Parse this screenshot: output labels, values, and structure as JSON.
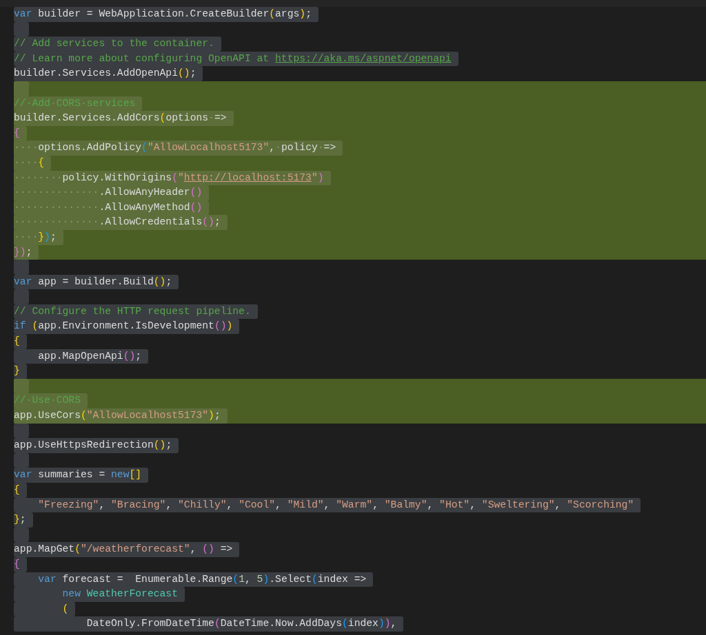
{
  "editor": {
    "lines": [
      {
        "selected": true,
        "added": false,
        "tokens": [
          {
            "kind": "kw",
            "text": "var"
          },
          {
            "kind": "id",
            "text": " builder = WebApplication.CreateBuilder"
          },
          {
            "kind": "b1",
            "text": "("
          },
          {
            "kind": "id",
            "text": "args"
          },
          {
            "kind": "b1",
            "text": ")"
          },
          {
            "kind": "id",
            "text": ";"
          }
        ]
      },
      {
        "selected": true,
        "added": false
      },
      {
        "selected": true,
        "added": false,
        "tokens": [
          {
            "kind": "cm",
            "text": "// Add services to the container."
          }
        ]
      },
      {
        "selected": true,
        "added": false,
        "tokens": [
          {
            "kind": "cm",
            "text": "// Learn more about configuring OpenAPI at "
          },
          {
            "kind": "link",
            "text": "https://aka.ms/aspnet/openapi"
          }
        ]
      },
      {
        "selected": true,
        "added": false,
        "tokens": [
          {
            "kind": "id",
            "text": "builder.Services.AddOpenApi"
          },
          {
            "kind": "b1",
            "text": "()"
          },
          {
            "kind": "id",
            "text": ";"
          }
        ]
      },
      {
        "selected": true,
        "added": true
      },
      {
        "selected": true,
        "added": true,
        "tokens": [
          {
            "kind": "cm",
            "text": "//·Add·CORS·services"
          }
        ]
      },
      {
        "selected": true,
        "added": true,
        "tokens": [
          {
            "kind": "id",
            "text": "builder.Services.AddCors"
          },
          {
            "kind": "b1",
            "text": "("
          },
          {
            "kind": "id",
            "text": "options"
          },
          {
            "kind": "ws",
            "text": "·"
          },
          {
            "kind": "id",
            "text": "=>"
          }
        ]
      },
      {
        "selected": true,
        "added": true,
        "tokens": [
          {
            "kind": "b2",
            "text": "{"
          }
        ]
      },
      {
        "selected": true,
        "added": true,
        "tokens": [
          {
            "kind": "ws",
            "text": "····"
          },
          {
            "kind": "id",
            "text": "options.AddPolicy"
          },
          {
            "kind": "b3",
            "text": "("
          },
          {
            "kind": "str",
            "text": "\"AllowLocalhost5173\""
          },
          {
            "kind": "id",
            "text": ","
          },
          {
            "kind": "ws",
            "text": "·"
          },
          {
            "kind": "id",
            "text": "policy"
          },
          {
            "kind": "ws",
            "text": "·"
          },
          {
            "kind": "id",
            "text": "=>"
          }
        ]
      },
      {
        "selected": true,
        "added": true,
        "tokens": [
          {
            "kind": "ws",
            "text": "····"
          },
          {
            "kind": "b1",
            "text": "{"
          }
        ]
      },
      {
        "selected": true,
        "added": true,
        "tokens": [
          {
            "kind": "ws",
            "text": "········"
          },
          {
            "kind": "id",
            "text": "policy.WithOrigins"
          },
          {
            "kind": "b2",
            "text": "("
          },
          {
            "kind": "str",
            "text": "\""
          },
          {
            "kind": "strlink",
            "text": "http://localhost:5173"
          },
          {
            "kind": "str",
            "text": "\""
          },
          {
            "kind": "b2",
            "text": ")"
          }
        ]
      },
      {
        "selected": true,
        "added": true,
        "tokens": [
          {
            "kind": "ws",
            "text": "··············"
          },
          {
            "kind": "id",
            "text": ".AllowAnyHeader"
          },
          {
            "kind": "b2",
            "text": "()"
          }
        ]
      },
      {
        "selected": true,
        "added": true,
        "tokens": [
          {
            "kind": "ws",
            "text": "··············"
          },
          {
            "kind": "id",
            "text": ".AllowAnyMethod"
          },
          {
            "kind": "b2",
            "text": "()"
          }
        ]
      },
      {
        "selected": true,
        "added": true,
        "tokens": [
          {
            "kind": "ws",
            "text": "··············"
          },
          {
            "kind": "id",
            "text": ".AllowCredentials"
          },
          {
            "kind": "b2",
            "text": "()"
          },
          {
            "kind": "id",
            "text": ";"
          }
        ]
      },
      {
        "selected": true,
        "added": true,
        "tokens": [
          {
            "kind": "ws",
            "text": "····"
          },
          {
            "kind": "b1",
            "text": "}"
          },
          {
            "kind": "b3",
            "text": ")"
          },
          {
            "kind": "id",
            "text": ";"
          }
        ]
      },
      {
        "selected": true,
        "added": true,
        "tokens": [
          {
            "kind": "b2",
            "text": "})"
          },
          {
            "kind": "id",
            "text": ";"
          }
        ]
      },
      {
        "selected": true,
        "added": false
      },
      {
        "selected": true,
        "added": false,
        "tokens": [
          {
            "kind": "kw",
            "text": "var"
          },
          {
            "kind": "id",
            "text": " app = builder.Build"
          },
          {
            "kind": "b1",
            "text": "()"
          },
          {
            "kind": "id",
            "text": ";"
          }
        ]
      },
      {
        "selected": true,
        "added": false
      },
      {
        "selected": true,
        "added": false,
        "tokens": [
          {
            "kind": "cm",
            "text": "// Configure the HTTP request pipeline."
          }
        ]
      },
      {
        "selected": true,
        "added": false,
        "tokens": [
          {
            "kind": "kw",
            "text": "if"
          },
          {
            "kind": "b1",
            "text": " ("
          },
          {
            "kind": "id",
            "text": "app.Environment.IsDevelopment"
          },
          {
            "kind": "b2",
            "text": "()"
          },
          {
            "kind": "b1",
            "text": ")"
          }
        ]
      },
      {
        "selected": true,
        "added": false,
        "tokens": [
          {
            "kind": "b1",
            "text": "{"
          }
        ]
      },
      {
        "selected": true,
        "added": false,
        "tokens": [
          {
            "kind": "id",
            "text": "    app.MapOpenApi"
          },
          {
            "kind": "b2",
            "text": "()"
          },
          {
            "kind": "id",
            "text": ";"
          }
        ]
      },
      {
        "selected": true,
        "added": false,
        "tokens": [
          {
            "kind": "b1",
            "text": "}"
          }
        ]
      },
      {
        "selected": true,
        "added": true
      },
      {
        "selected": true,
        "added": true,
        "tokens": [
          {
            "kind": "cm",
            "text": "//·Use·CORS"
          }
        ]
      },
      {
        "selected": true,
        "added": true,
        "tokens": [
          {
            "kind": "id",
            "text": "app.UseCors"
          },
          {
            "kind": "b1",
            "text": "("
          },
          {
            "kind": "str",
            "text": "\"AllowLocalhost5173\""
          },
          {
            "kind": "b1",
            "text": ")"
          },
          {
            "kind": "id",
            "text": ";"
          }
        ]
      },
      {
        "selected": true,
        "added": false
      },
      {
        "selected": true,
        "added": false,
        "tokens": [
          {
            "kind": "id",
            "text": "app.UseHttpsRedirection"
          },
          {
            "kind": "b1",
            "text": "()"
          },
          {
            "kind": "id",
            "text": ";"
          }
        ]
      },
      {
        "selected": true,
        "added": false
      },
      {
        "selected": true,
        "added": false,
        "tokens": [
          {
            "kind": "kw",
            "text": "var"
          },
          {
            "kind": "id",
            "text": " summaries = "
          },
          {
            "kind": "kw",
            "text": "new"
          },
          {
            "kind": "b1",
            "text": "[]"
          }
        ]
      },
      {
        "selected": true,
        "added": false,
        "tokens": [
          {
            "kind": "b1",
            "text": "{"
          }
        ]
      },
      {
        "selected": true,
        "added": false,
        "tokens": [
          {
            "kind": "str",
            "text": "    \"Freezing\""
          },
          {
            "kind": "id",
            "text": ", "
          },
          {
            "kind": "str",
            "text": "\"Bracing\""
          },
          {
            "kind": "id",
            "text": ", "
          },
          {
            "kind": "str",
            "text": "\"Chilly\""
          },
          {
            "kind": "id",
            "text": ", "
          },
          {
            "kind": "str",
            "text": "\"Cool\""
          },
          {
            "kind": "id",
            "text": ", "
          },
          {
            "kind": "str",
            "text": "\"Mild\""
          },
          {
            "kind": "id",
            "text": ", "
          },
          {
            "kind": "str",
            "text": "\"Warm\""
          },
          {
            "kind": "id",
            "text": ", "
          },
          {
            "kind": "str",
            "text": "\"Balmy\""
          },
          {
            "kind": "id",
            "text": ", "
          },
          {
            "kind": "str",
            "text": "\"Hot\""
          },
          {
            "kind": "id",
            "text": ", "
          },
          {
            "kind": "str",
            "text": "\"Sweltering\""
          },
          {
            "kind": "id",
            "text": ", "
          },
          {
            "kind": "str",
            "text": "\"Scorching\""
          }
        ]
      },
      {
        "selected": true,
        "added": false,
        "tokens": [
          {
            "kind": "b1",
            "text": "}"
          },
          {
            "kind": "id",
            "text": ";"
          }
        ]
      },
      {
        "selected": true,
        "added": false
      },
      {
        "selected": true,
        "added": false,
        "tokens": [
          {
            "kind": "id",
            "text": "app.MapGet"
          },
          {
            "kind": "b1",
            "text": "("
          },
          {
            "kind": "str",
            "text": "\"/weatherforecast\""
          },
          {
            "kind": "id",
            "text": ", "
          },
          {
            "kind": "b2",
            "text": "()"
          },
          {
            "kind": "id",
            "text": " =>"
          }
        ]
      },
      {
        "selected": true,
        "added": false,
        "tokens": [
          {
            "kind": "b2",
            "text": "{"
          }
        ]
      },
      {
        "selected": true,
        "added": false,
        "tokens": [
          {
            "kind": "kw",
            "text": "    var"
          },
          {
            "kind": "id",
            "text": " forecast =  Enumerable.Range"
          },
          {
            "kind": "b3",
            "text": "("
          },
          {
            "kind": "num",
            "text": "1"
          },
          {
            "kind": "id",
            "text": ", "
          },
          {
            "kind": "num",
            "text": "5"
          },
          {
            "kind": "b3",
            "text": ")"
          },
          {
            "kind": "id",
            "text": ".Select"
          },
          {
            "kind": "b3",
            "text": "("
          },
          {
            "kind": "id",
            "text": "index =>"
          }
        ]
      },
      {
        "selected": true,
        "added": false,
        "tokens": [
          {
            "kind": "kw",
            "text": "        new"
          },
          {
            "kind": "type",
            "text": " WeatherForecast"
          }
        ]
      },
      {
        "selected": true,
        "added": false,
        "tokens": [
          {
            "kind": "b1",
            "text": "        ("
          }
        ]
      },
      {
        "selected": true,
        "added": false,
        "tokens": [
          {
            "kind": "id",
            "text": "            DateOnly.FromDateTime"
          },
          {
            "kind": "b2",
            "text": "("
          },
          {
            "kind": "id",
            "text": "DateTime.Now.AddDays"
          },
          {
            "kind": "b3",
            "text": "("
          },
          {
            "kind": "id",
            "text": "index"
          },
          {
            "kind": "b3",
            "text": ")"
          },
          {
            "kind": "b2",
            "text": ")"
          },
          {
            "kind": "id",
            "text": ","
          }
        ]
      }
    ]
  }
}
